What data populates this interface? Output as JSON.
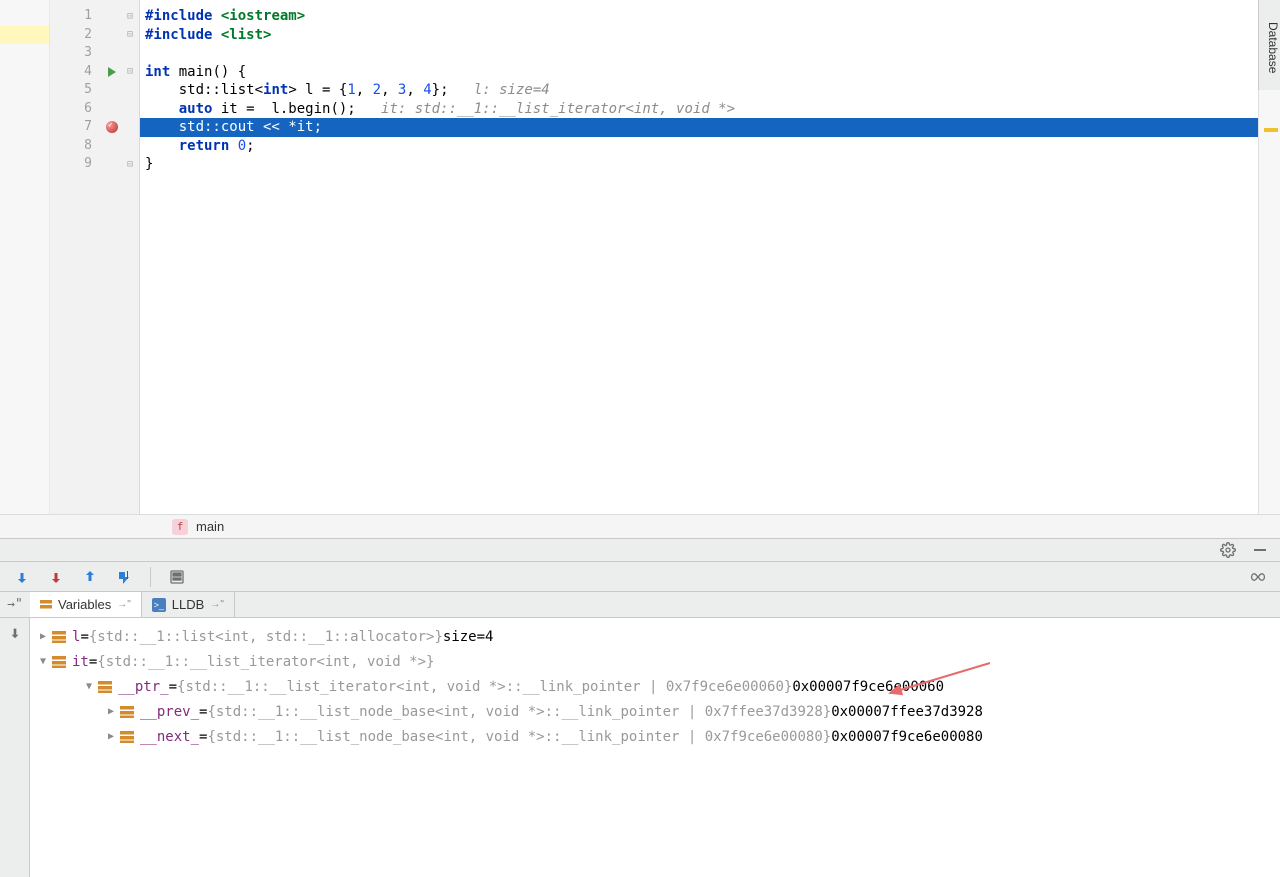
{
  "sidebar": {
    "database_label": "Database"
  },
  "code": {
    "lines": [
      {
        "n": 1
      },
      {
        "n": 2
      },
      {
        "n": 3
      },
      {
        "n": 4,
        "run": true
      },
      {
        "n": 5
      },
      {
        "n": 6
      },
      {
        "n": 7,
        "bp": true,
        "current": true
      },
      {
        "n": 8
      },
      {
        "n": 9
      }
    ],
    "tokens": {
      "include": "#include",
      "iostream": "<iostream>",
      "list_hdr": "<list>",
      "int_kw": "int",
      "main_fn": "main() {",
      "std_list": "std::list",
      "int_tmpl": "<int>",
      "l_init": " l = {",
      "one": "1",
      "two": "2",
      "three": "3",
      "four": "4",
      "close_init": "};",
      "hint_l": "l: size=4",
      "auto_kw": "auto",
      "it_decl": " it =  l.begin();",
      "hint_it": "it: std::__1::__list_iterator<int, void *>",
      "cout_line": "std::cout << *it;",
      "return_kw": "return",
      "zero": "0",
      "semi": ";",
      "close_brace": "}"
    }
  },
  "breadcrumb": {
    "icon": "f",
    "name": "main"
  },
  "tabs": {
    "variables": "Variables",
    "lldb": "LLDB"
  },
  "variables": {
    "rows": [
      {
        "indent": 0,
        "open": false,
        "name": "l",
        "eq": " = ",
        "type": "{std::__1::list<int, std::__1::allocator>} ",
        "val": "size=4"
      },
      {
        "indent": 0,
        "open": true,
        "name": "it",
        "eq": " = ",
        "type": "{std::__1::__list_iterator<int, void *>}",
        "val": ""
      },
      {
        "indent": 1,
        "open": true,
        "name": "__ptr_",
        "eq": " = ",
        "type": "{std::__1::__list_iterator<int, void *>::__link_pointer | 0x7f9ce6e00060} ",
        "val": "0x00007f9ce6e00060"
      },
      {
        "indent": 2,
        "open": false,
        "name": "__prev_",
        "eq": " = ",
        "type": "{std::__1::__list_node_base<int, void *>::__link_pointer | 0x7ffee37d3928} ",
        "val": "0x00007ffee37d3928"
      },
      {
        "indent": 2,
        "open": false,
        "name": "__next_",
        "eq": " = ",
        "type": "{std::__1::__list_node_base<int, void *>::__link_pointer | 0x7f9ce6e00080} ",
        "val": "0x00007f9ce6e00080"
      }
    ]
  }
}
